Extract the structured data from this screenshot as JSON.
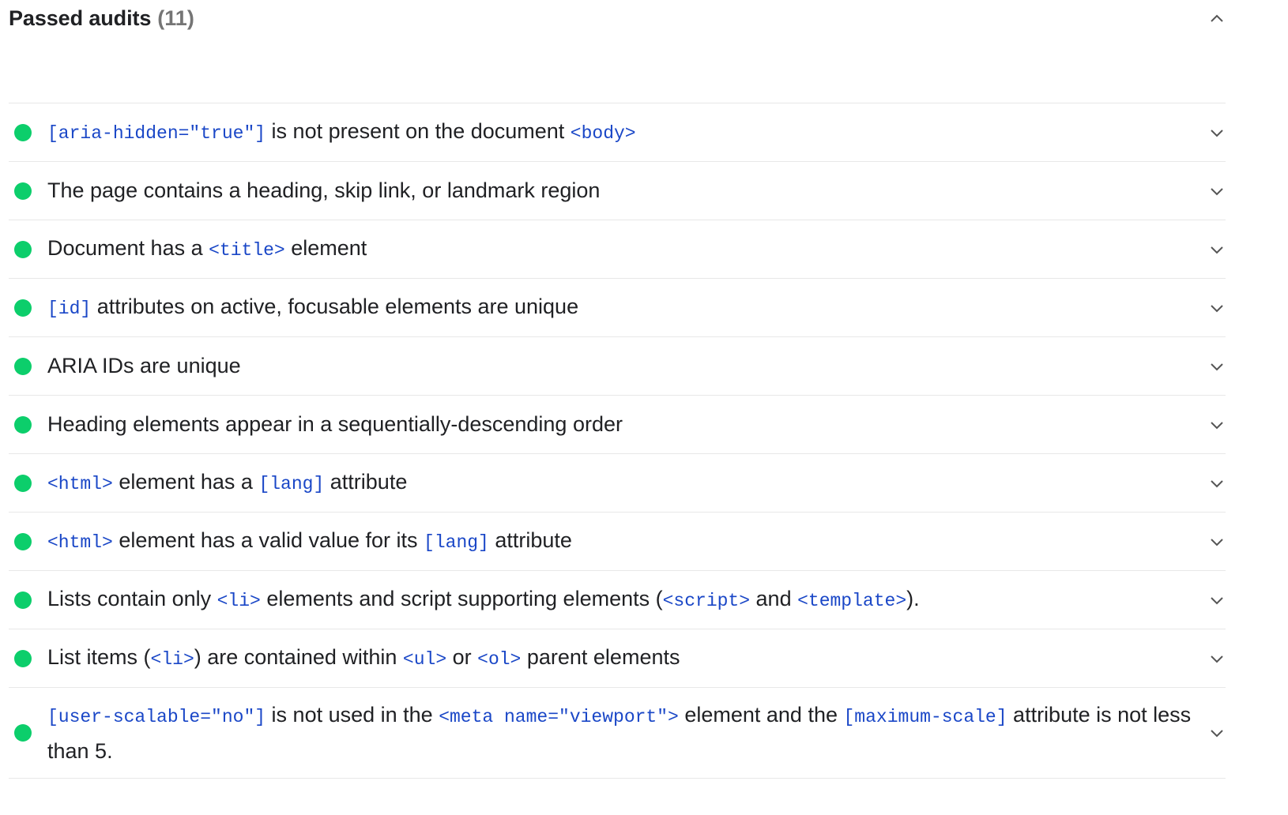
{
  "group": {
    "title": "Passed audits",
    "count": "(11)"
  },
  "audits": [
    {
      "parts": [
        {
          "t": "code",
          "v": "[aria-hidden=\"true\"]"
        },
        {
          "t": "text",
          "v": " is not present on the document "
        },
        {
          "t": "code",
          "v": "<body>"
        }
      ]
    },
    {
      "parts": [
        {
          "t": "text",
          "v": "The page contains a heading, skip link, or landmark region"
        }
      ]
    },
    {
      "parts": [
        {
          "t": "text",
          "v": "Document has a "
        },
        {
          "t": "code",
          "v": "<title>"
        },
        {
          "t": "text",
          "v": " element"
        }
      ]
    },
    {
      "parts": [
        {
          "t": "code",
          "v": "[id]"
        },
        {
          "t": "text",
          "v": " attributes on active, focusable elements are unique"
        }
      ]
    },
    {
      "parts": [
        {
          "t": "text",
          "v": "ARIA IDs are unique"
        }
      ]
    },
    {
      "parts": [
        {
          "t": "text",
          "v": "Heading elements appear in a sequentially-descending order"
        }
      ]
    },
    {
      "parts": [
        {
          "t": "code",
          "v": "<html>"
        },
        {
          "t": "text",
          "v": " element has a "
        },
        {
          "t": "code",
          "v": "[lang]"
        },
        {
          "t": "text",
          "v": " attribute"
        }
      ]
    },
    {
      "parts": [
        {
          "t": "code",
          "v": "<html>"
        },
        {
          "t": "text",
          "v": " element has a valid value for its "
        },
        {
          "t": "code",
          "v": "[lang]"
        },
        {
          "t": "text",
          "v": " attribute"
        }
      ]
    },
    {
      "parts": [
        {
          "t": "text",
          "v": "Lists contain only "
        },
        {
          "t": "code",
          "v": "<li>"
        },
        {
          "t": "text",
          "v": " elements and script supporting elements ("
        },
        {
          "t": "code",
          "v": "<script>"
        },
        {
          "t": "text",
          "v": " and "
        },
        {
          "t": "code",
          "v": "<template>"
        },
        {
          "t": "text",
          "v": ")."
        }
      ]
    },
    {
      "parts": [
        {
          "t": "text",
          "v": "List items ("
        },
        {
          "t": "code",
          "v": "<li>"
        },
        {
          "t": "text",
          "v": ") are contained within "
        },
        {
          "t": "code",
          "v": "<ul>"
        },
        {
          "t": "text",
          "v": " or "
        },
        {
          "t": "code",
          "v": "<ol>"
        },
        {
          "t": "text",
          "v": " parent elements"
        }
      ]
    },
    {
      "tall": true,
      "parts": [
        {
          "t": "code",
          "v": "[user-scalable=\"no\"]"
        },
        {
          "t": "text",
          "v": " is not used in the "
        },
        {
          "t": "code",
          "v": "<meta name=\"viewport\">"
        },
        {
          "t": "text",
          "v": " element and the "
        },
        {
          "t": "code",
          "v": "[maximum-scale]"
        },
        {
          "t": "text",
          "v": " attribute is not less than 5."
        }
      ]
    }
  ],
  "colors": {
    "pass": "#0cce6b",
    "code": "#1a47c7",
    "count": "#757575"
  },
  "icons": {
    "header": "chevron-up-icon",
    "row": "chevron-down-icon"
  }
}
